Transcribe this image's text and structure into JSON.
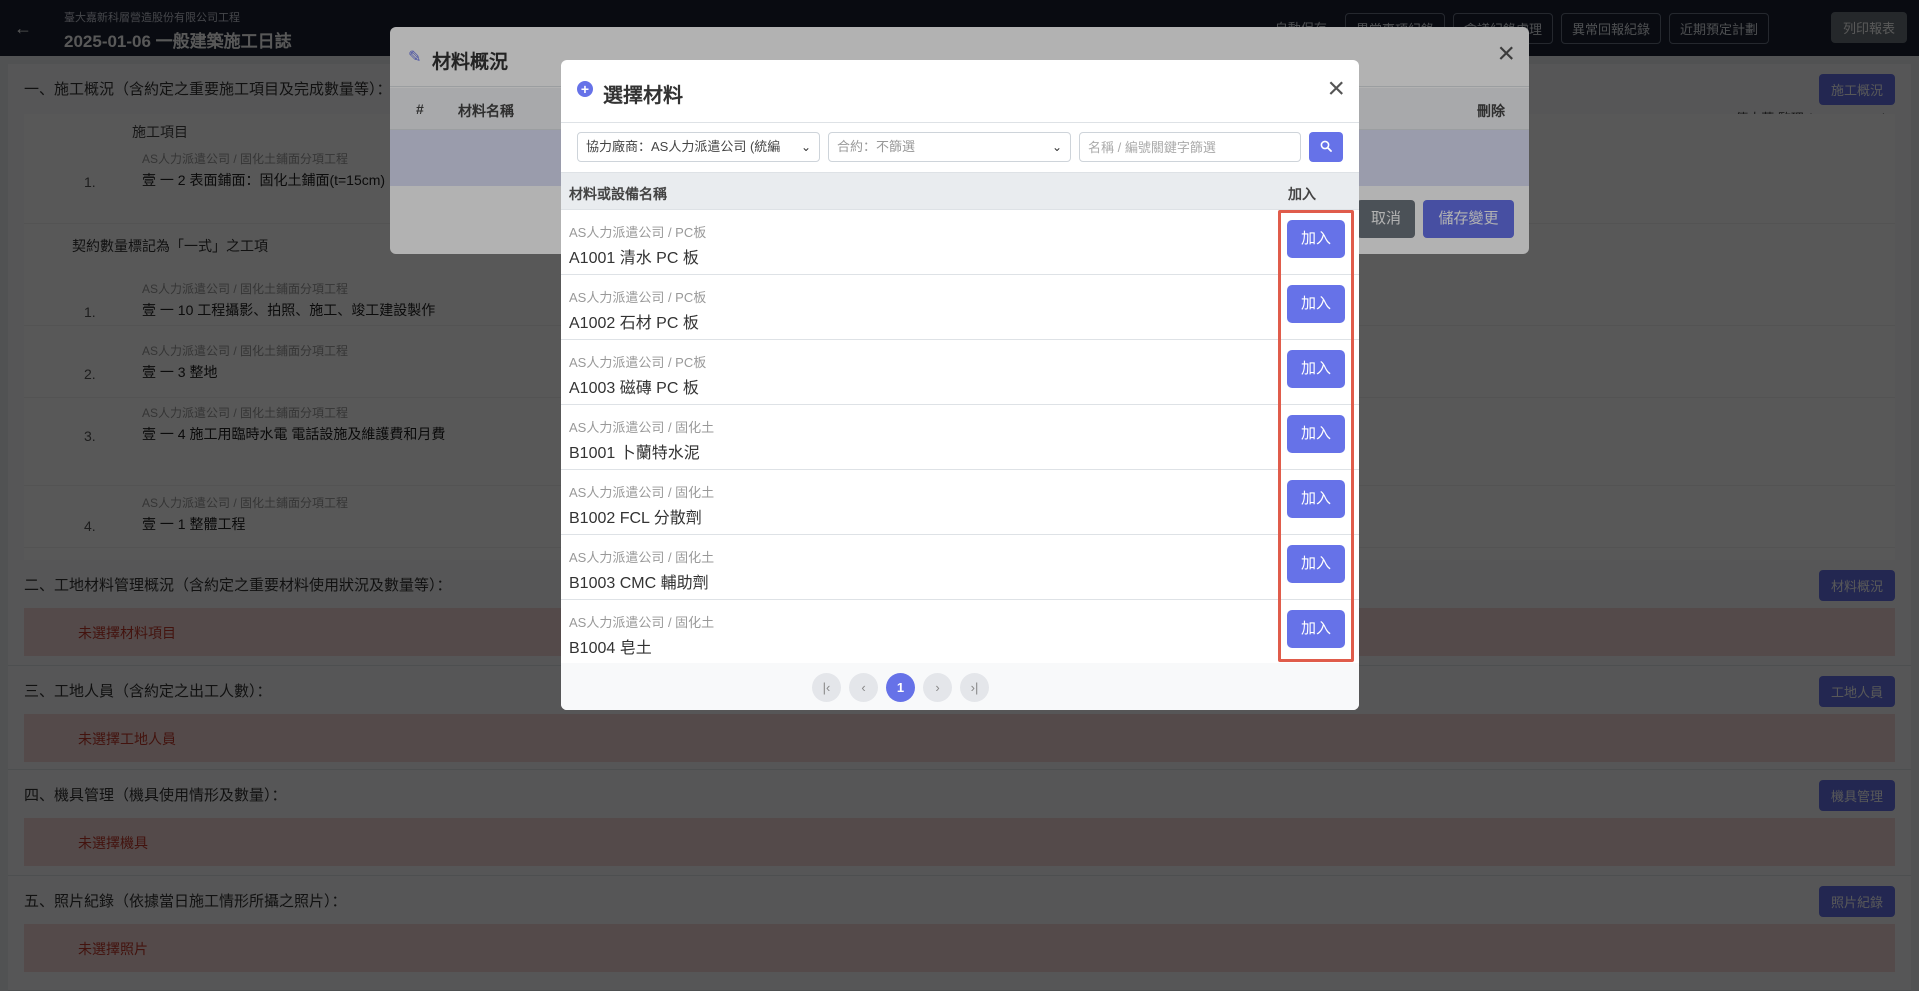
{
  "topbar": {
    "back_icon": "←",
    "org": "臺大嘉新科層營造股份有限公司工程",
    "title": "2025-01-06 一般建築施工日誌",
    "nav": [
      "自動保存",
      "異常事項紀錄",
      "會議紀錄處理",
      "異常回報紀錄",
      "近期預定計劃"
    ],
    "print": "列印報表"
  },
  "background": {
    "section1_title": "一、施工概況（含約定之重要施工項目及完成數量等）：",
    "section1_button": "施工概況",
    "supervisor": "傳大莉 監理 ( cyanne001 )",
    "col_header": "施工項目",
    "tasks": [
      {
        "num": "1.",
        "sub": "AS人力派遣公司 / 固化土鋪面分項工程",
        "name": "壹 一 2 表面鋪面：固化土鋪面(t=15cm)"
      },
      {
        "num": "1.",
        "sub": "AS人力派遣公司 / 固化土鋪面分項工程",
        "name": "壹 一 10 工程攝影、拍照、施工、竣工建設製作"
      },
      {
        "num": "2.",
        "sub": "AS人力派遣公司 / 固化土鋪面分項工程",
        "name": "壹 一 3 整地"
      },
      {
        "num": "3.",
        "sub": "AS人力派遣公司 / 固化土鋪面分項工程",
        "name": "壹 一 4 施工用臨時水電 電話設施及維護費和月費"
      },
      {
        "num": "4.",
        "sub": "AS人力派遣公司 / 固化土鋪面分項工程",
        "name": "壹 一 1 整體工程"
      }
    ],
    "lump_sum_note": "契約數量標記為「一式」之工項",
    "section2_title": "二、工地材料管理概況（含約定之重要材料使用狀況及數量等）：",
    "section2_button": "材料概況",
    "section2_empty": "未選擇材料項目",
    "section3_title": "三、工地人員（含約定之出工人數）：",
    "section3_button": "工地人員",
    "section3_empty": "未選擇工地人員",
    "section4_title": "四、機具管理（機具使用情形及數量）：",
    "section4_button": "機具管理",
    "section4_empty": "未選擇機具",
    "section5_title": "五、照片紀錄（依據當日施工情形所攝之照片）：",
    "section5_button": "照片紀錄",
    "section5_empty": "未選擇照片"
  },
  "material_overview_modal": {
    "title": "材料概況",
    "columns": {
      "index": "#",
      "name": "材料名稱",
      "delete": "刪除"
    },
    "cancel": "取消",
    "save": "儲存變更"
  },
  "select_material_modal": {
    "title": "選擇材料",
    "vendor_filter": "協力廠商：AS人力派遣公司 (統編",
    "contract_filter": "合約：不篩選",
    "keyword_placeholder": "名稱 / 編號關鍵字篩選",
    "columns": {
      "name": "材料或設備名稱",
      "add": "加入"
    },
    "add_label": "加入",
    "rows": [
      {
        "path": "AS人力派遣公司 / PC板",
        "name": "A1001 清水 PC 板"
      },
      {
        "path": "AS人力派遣公司 / PC板",
        "name": "A1002 石材 PC 板"
      },
      {
        "path": "AS人力派遣公司 / PC板",
        "name": "A1003 磁磚 PC 板"
      },
      {
        "path": "AS人力派遣公司 / 固化土",
        "name": "B1001 卜蘭特水泥"
      },
      {
        "path": "AS人力派遣公司 / 固化土",
        "name": "B1002 FCL 分散劑"
      },
      {
        "path": "AS人力派遣公司 / 固化土",
        "name": "B1003 CMC 輔助劑"
      },
      {
        "path": "AS人力派遣公司 / 固化土",
        "name": "B1004 皂土"
      }
    ],
    "pagination": {
      "current": "1",
      "first": "|‹",
      "prev": "‹",
      "next": "›",
      "last": "›|"
    }
  },
  "colors": {
    "accent": "#6672e8",
    "highlight_border": "#e05c4b"
  }
}
